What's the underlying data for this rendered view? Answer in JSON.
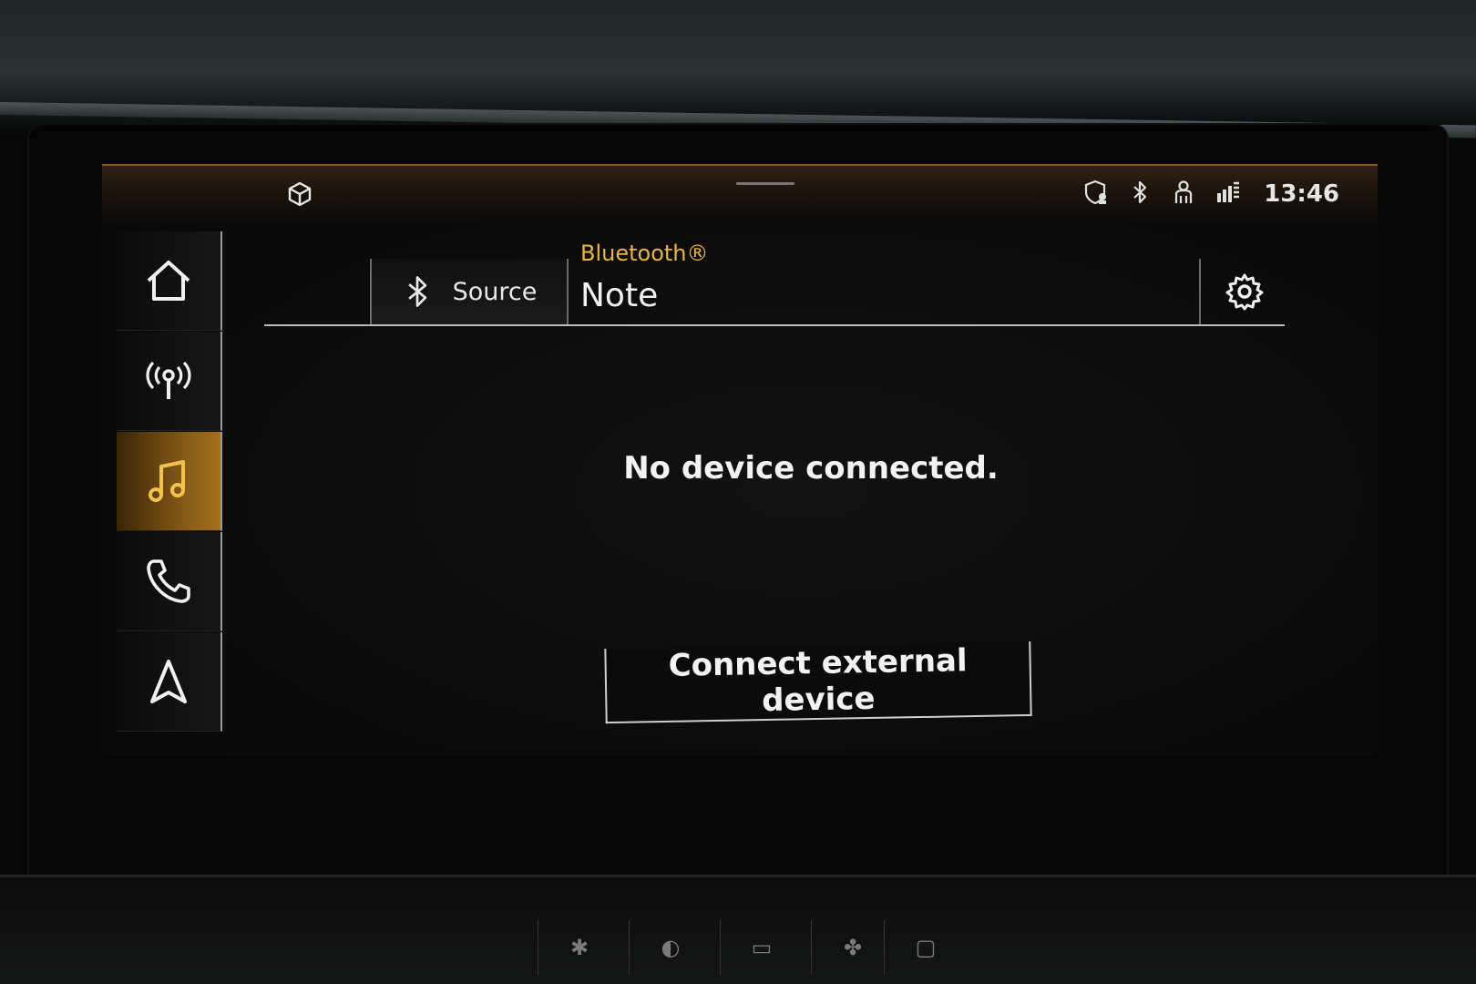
{
  "status_bar": {
    "time": "13:46",
    "icons": [
      "cube-icon",
      "shield-user-icon",
      "bluetooth-icon",
      "user-icon",
      "data-icon"
    ]
  },
  "nav": {
    "items": [
      {
        "name": "home",
        "icon": "home-icon"
      },
      {
        "name": "radio",
        "icon": "antenna-icon"
      },
      {
        "name": "media",
        "icon": "music-note-icon",
        "active": true
      },
      {
        "name": "phone",
        "icon": "phone-icon"
      },
      {
        "name": "navigation",
        "icon": "navigation-arrow-icon"
      }
    ]
  },
  "header": {
    "source_label": "Source",
    "source_icon": "bluetooth-icon",
    "connection_type": "Bluetooth®",
    "device_name": "Note",
    "settings_icon": "gear-icon"
  },
  "main": {
    "message": "No device connected.",
    "connect_button_label": "Connect external device"
  },
  "colors": {
    "accent": "#e9b73e",
    "active_tab": "#a4701f",
    "background": "#0b0b0b",
    "text": "#f2f2f2"
  }
}
